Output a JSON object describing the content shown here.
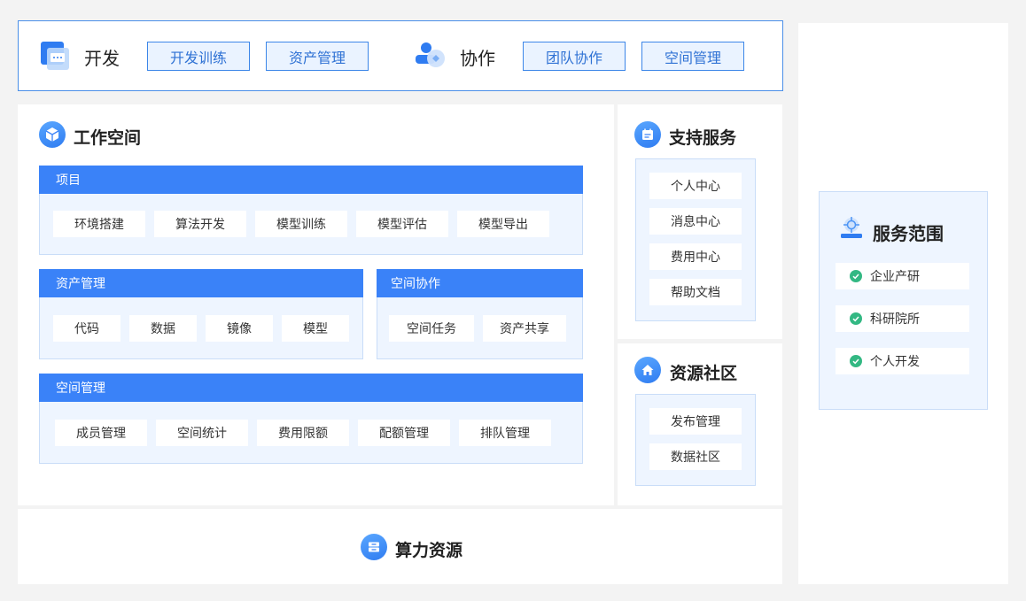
{
  "header": {
    "dev": {
      "label": "开发",
      "buttons": [
        "开发训练",
        "资产管理"
      ]
    },
    "collab": {
      "label": "协作",
      "buttons": [
        "团队协作",
        "空间管理"
      ]
    }
  },
  "workspace": {
    "title": "工作空间",
    "project": {
      "title": "项目",
      "items": [
        "环境搭建",
        "算法开发",
        "模型训练",
        "模型评估",
        "模型导出"
      ]
    },
    "assets": {
      "title": "资产管理",
      "items": [
        "代码",
        "数据",
        "镜像",
        "模型"
      ]
    },
    "space_collab": {
      "title": "空间协作",
      "items": [
        "空间任务",
        "资产共享"
      ]
    },
    "space_mgmt": {
      "title": "空间管理",
      "items": [
        "成员管理",
        "空间统计",
        "费用限额",
        "配额管理",
        "排队管理"
      ]
    }
  },
  "support": {
    "title": "支持服务",
    "items": [
      "个人中心",
      "消息中心",
      "费用中心",
      "帮助文档"
    ]
  },
  "community": {
    "title": "资源社区",
    "items": [
      "发布管理",
      "数据社区"
    ]
  },
  "compute": {
    "title": "算力资源"
  },
  "scope": {
    "title": "服务范围",
    "items": [
      "企业产研",
      "科研院所",
      "个人开发"
    ]
  },
  "colors": {
    "primary": "#3a82f8",
    "light_bg": "#eef5ff",
    "check": "#33b883"
  }
}
